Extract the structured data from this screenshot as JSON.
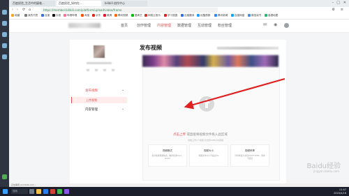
{
  "browser": {
    "tabs": [
      {
        "label": "百度经验_生活中的疑难..."
      },
      {
        "label": "百度经验_如何在...",
        "active": true
      },
      {
        "label": "bilibili 创作中心"
      }
    ],
    "url": "https://member.bilibili.com/platform/upload/video/frame",
    "bookmarks": [
      "收藏",
      "我的书签",
      "百度",
      "抖音",
      "哔哩哔哩",
      "淘宝",
      "京东",
      "微博",
      "腾讯视频",
      "爱奇艺",
      "网易云音乐",
      "学习强国",
      "百度翻译",
      "优酷视频",
      "腾讯新闻",
      "百度网盘",
      "微信读书",
      "高德地图"
    ],
    "colors": {
      "accent": "#e54e4e",
      "tab_bg": "#e9edf0",
      "rail": "#2e3440"
    }
  },
  "topnav": {
    "items": [
      "首页",
      "创作管理",
      "内容管理",
      "数据管理",
      "互动管理",
      "粉丝管理"
    ],
    "active": "内容管理"
  },
  "sidebar": {
    "menu": [
      {
        "label": "发布视频",
        "expanded": true,
        "active": true
      },
      {
        "label": "上传视频",
        "sub": true,
        "selected": true
      },
      {
        "label": "内容管理",
        "expanded": false
      }
    ]
  },
  "main": {
    "title": "发布视频",
    "upload_link": "点击上传",
    "upload_hint": "或直接将视频文件拖入此区域",
    "upload_note": "当前上传1个视频 仅支持3GB以内视频",
    "cards": [
      {
        "title": "视频格式",
        "desc": "支持常用视频格式，推荐使用mp4、webm"
      },
      {
        "title": "视频大小",
        "desc": "视频文件大小不超过3G"
      },
      {
        "title": "视频码率",
        "desc": "分辨率最大支持1920*1080，码率不超过"
      }
    ]
  },
  "watermark": {
    "text": "Baidu经验",
    "sub": "jingyan.baidu.com"
  },
  "status": {
    "text": "正在等待 s1.hdslb.com..."
  },
  "taskbar": {
    "search": "搜索",
    "time": "11:47",
    "date": "2020/4/18"
  }
}
